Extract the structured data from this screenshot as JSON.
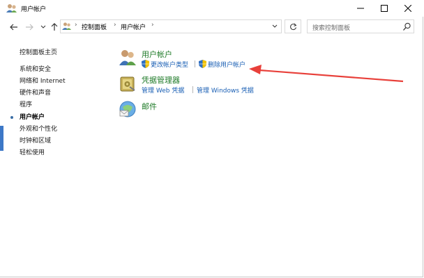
{
  "window": {
    "title": "用户帐户"
  },
  "titlebar_buttons": {
    "minimize": "—",
    "maximize": "☐",
    "close": "✕"
  },
  "address": {
    "crumbs": [
      "控制面板",
      "用户帐户"
    ],
    "search_placeholder": "搜索控制面板"
  },
  "left_pane": {
    "home": "控制面板主页",
    "items": [
      {
        "label": "系统和安全",
        "current": false
      },
      {
        "label": "网络和 Internet",
        "current": false
      },
      {
        "label": "硬件和声音",
        "current": false
      },
      {
        "label": "程序",
        "current": false
      },
      {
        "label": "用户帐户",
        "current": true
      },
      {
        "label": "外观和个性化",
        "current": false
      },
      {
        "label": "时钟和区域",
        "current": false
      },
      {
        "label": "轻松使用",
        "current": false
      }
    ]
  },
  "main": {
    "categories": [
      {
        "title": "用户帐户",
        "icon": "users-icon",
        "links": [
          "更改帐户类型",
          "删除用户帐户"
        ]
      },
      {
        "title": "凭据管理器",
        "icon": "credential-vault-icon",
        "links": [
          "管理 Web 凭据",
          "管理 Windows 凭据"
        ]
      },
      {
        "title": "邮件",
        "icon": "mail-icon",
        "links": []
      }
    ]
  },
  "annotation": {
    "arrow_color": "#e8403a"
  },
  "colors": {
    "category_title": "#1e7a27",
    "link": "#1a5fb4"
  }
}
